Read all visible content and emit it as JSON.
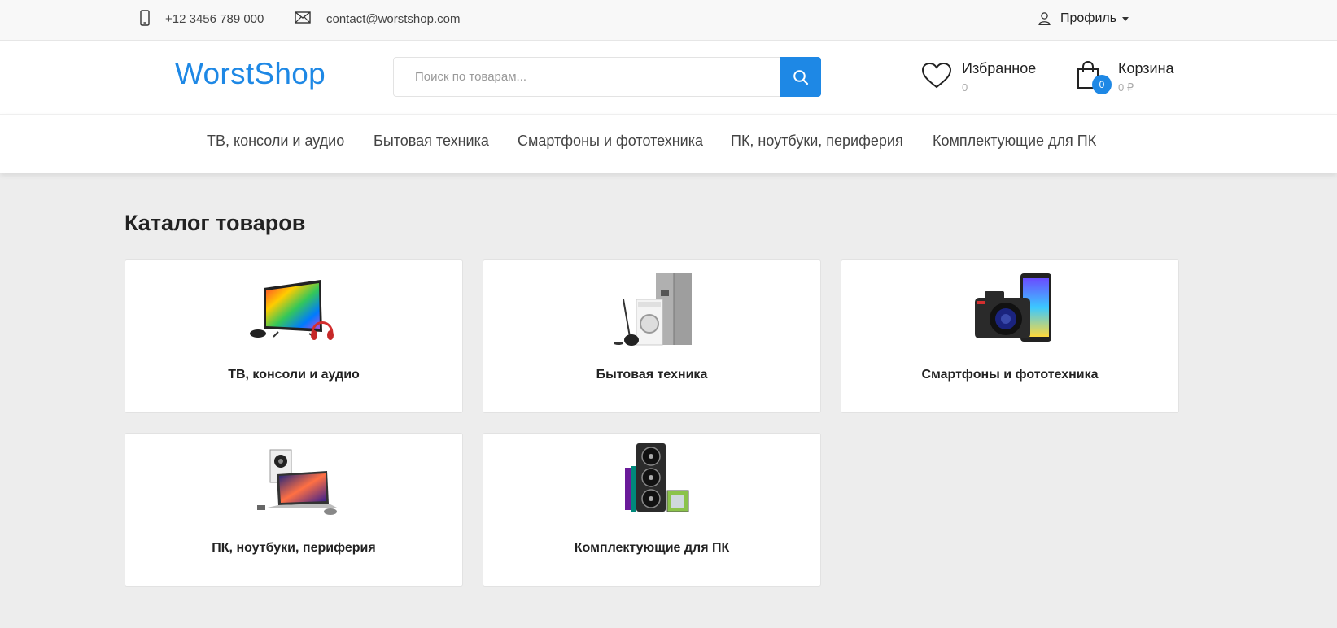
{
  "topbar": {
    "phone": "+12 3456 789 000",
    "email": "contact@worstshop.com",
    "profile_label": "Профиль"
  },
  "header": {
    "logo": "WorstShop",
    "search_placeholder": "Поиск по товарам...",
    "favorites_label": "Избранное",
    "favorites_count": "0",
    "cart_label": "Корзина",
    "cart_total": "0 ₽",
    "cart_badge": "0"
  },
  "nav": {
    "items": [
      {
        "label": "ТВ, консоли и аудио"
      },
      {
        "label": "Бытовая техника"
      },
      {
        "label": "Смартфоны и фототехника"
      },
      {
        "label": "ПК, ноутбуки, периферия"
      },
      {
        "label": "Комплектующие для ПК"
      }
    ]
  },
  "catalog": {
    "title": "Каталог товаров",
    "categories": [
      {
        "name": "ТВ, консоли и аудио",
        "image": "tv-console-audio-image"
      },
      {
        "name": "Бытовая техника",
        "image": "home-appliances-image"
      },
      {
        "name": "Смартфоны и фототехника",
        "image": "smartphone-camera-image"
      },
      {
        "name": "ПК, ноутбуки, периферия",
        "image": "laptop-pc-image"
      },
      {
        "name": "Комплектующие для ПК",
        "image": "pc-components-image"
      }
    ]
  },
  "colors": {
    "accent": "#1e88e5",
    "background": "#ededed",
    "topbar": "#f8f8f8"
  }
}
